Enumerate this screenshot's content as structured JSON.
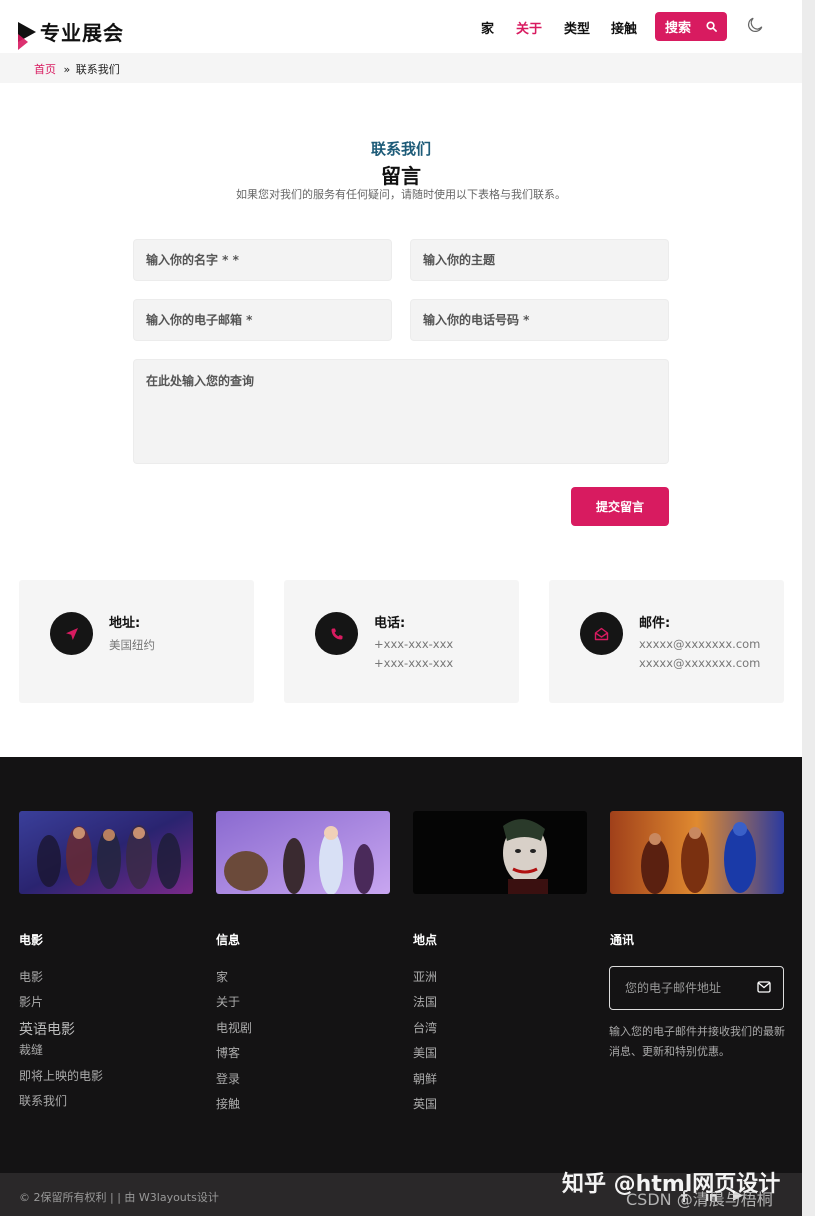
{
  "brand": {
    "name": "专业展会",
    "accent": "#d81b60"
  },
  "nav": {
    "items": [
      "家",
      "关于",
      "类型",
      "接触"
    ],
    "active_index": 1,
    "search_label": "搜索"
  },
  "breadcrumb": {
    "home": "首页",
    "separator": "»",
    "current": "联系我们"
  },
  "contact_section": {
    "subtitle": "联系我们",
    "title": "留言",
    "description": "如果您对我们的服务有任何疑问，请随时使用以下表格与我们联系。"
  },
  "form": {
    "name_placeholder": "输入你的名字 * *",
    "subject_placeholder": "输入你的主题",
    "email_placeholder": "输入你的电子邮箱 *",
    "phone_placeholder": "输入你的电话号码 *",
    "message_placeholder": "在此处输入您的查询",
    "submit_label": "提交留言"
  },
  "info_cards": [
    {
      "icon": "location-arrow-icon",
      "title": "地址:",
      "lines": [
        "美国纽约"
      ]
    },
    {
      "icon": "phone-icon",
      "title": "电话:",
      "lines": [
        "+xxx-xxx-xxx",
        "+xxx-xxx-xxx"
      ]
    },
    {
      "icon": "envelope-open-icon",
      "title": "邮件:",
      "lines": [
        "xxxxx@xxxxxxx.com",
        "xxxxx@xxxxxxx.com"
      ]
    }
  ],
  "footer": {
    "columns": [
      {
        "title": "电影",
        "links": [
          "电影",
          "影片",
          "英语电影",
          "裁缝",
          "即将上映的电影",
          "联系我们"
        ]
      },
      {
        "title": "信息",
        "links": [
          "家",
          "关于",
          "电视剧",
          "博客",
          "登录",
          "接触"
        ]
      },
      {
        "title": "地点",
        "links": [
          "亚洲",
          "法国",
          "台湾",
          "美国",
          "朝鲜",
          "英国"
        ]
      }
    ],
    "newsletter": {
      "title": "通讯",
      "email_placeholder": "您的电子邮件地址",
      "text": "输入您的电子邮件并接收我们的最新消息、更新和特别优惠。"
    },
    "copyright": "© 2保留所有权利 | | 由 W3layouts设计"
  },
  "watermark": {
    "main": "知乎 @html网页设计",
    "sub": "CSDN @清晨与梧桐"
  }
}
